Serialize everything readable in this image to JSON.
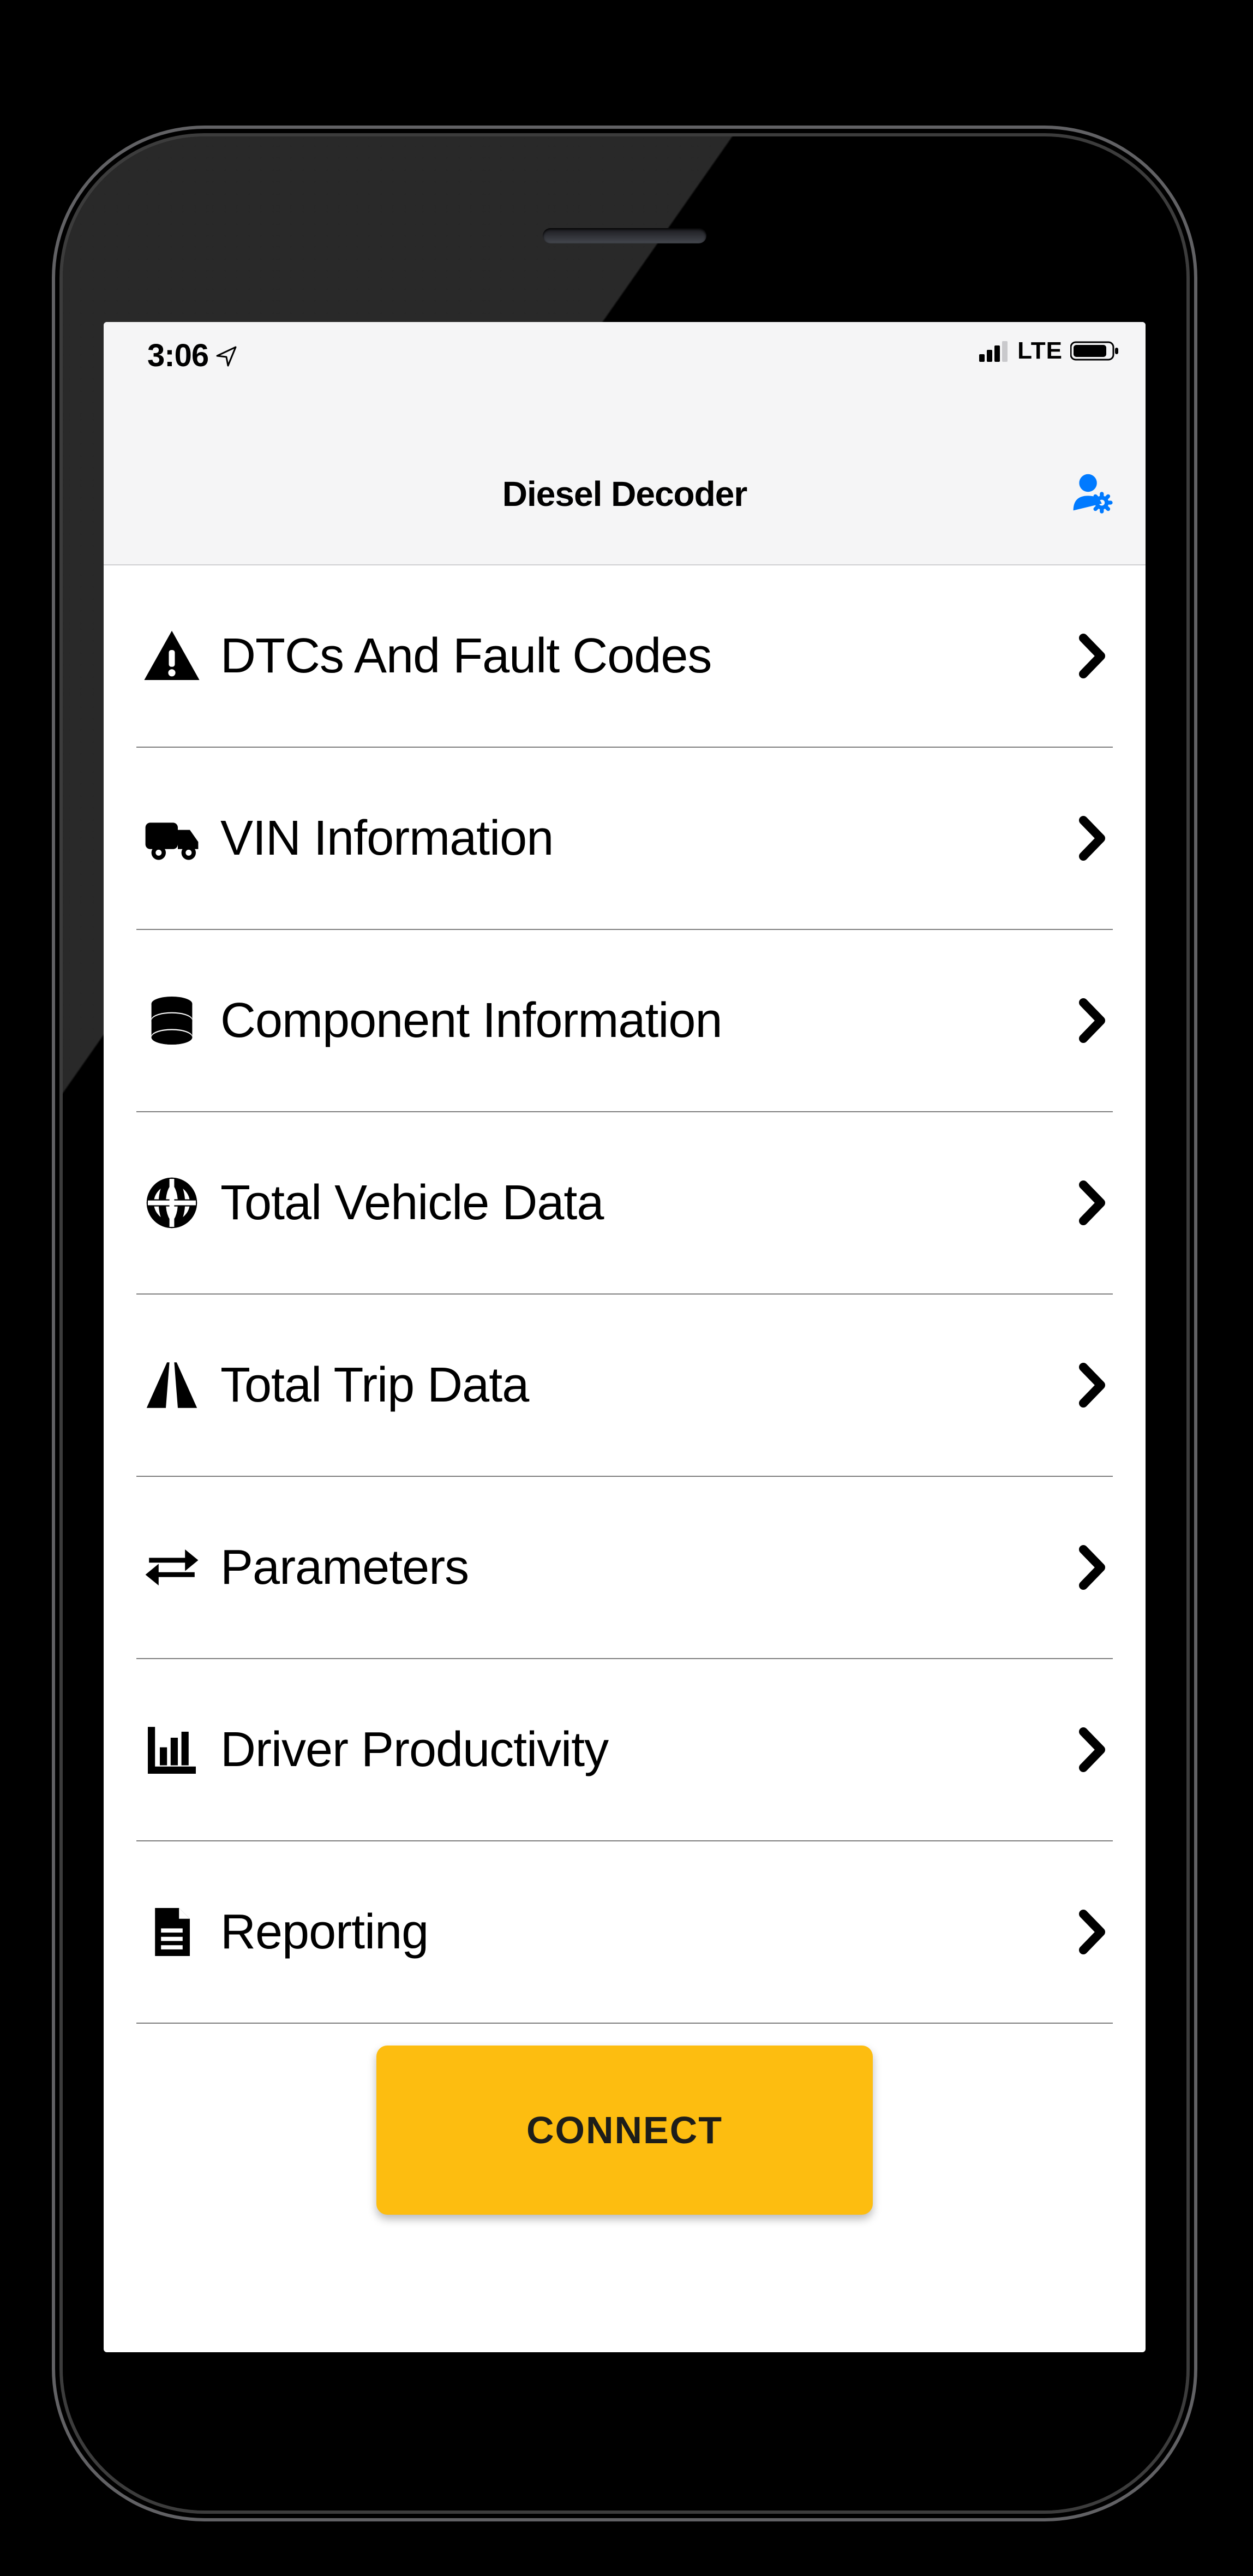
{
  "status": {
    "time": "3:06",
    "network_label": "LTE"
  },
  "header": {
    "title": "Diesel Decoder"
  },
  "menu": [
    {
      "icon": "warning-icon",
      "label": "DTCs And Fault Codes"
    },
    {
      "icon": "truck-icon",
      "label": "VIN Information"
    },
    {
      "icon": "database-icon",
      "label": "Component Information"
    },
    {
      "icon": "globe-icon",
      "label": "Total Vehicle Data"
    },
    {
      "icon": "road-icon",
      "label": "Total Trip Data"
    },
    {
      "icon": "swap-icon",
      "label": "Parameters"
    },
    {
      "icon": "chart-icon",
      "label": "Driver Productivity"
    },
    {
      "icon": "document-icon",
      "label": "Reporting"
    }
  ],
  "actions": {
    "connect_label": "CONNECT"
  },
  "colors": {
    "accent": "#007aff",
    "button_bg": "#fdbd10"
  }
}
